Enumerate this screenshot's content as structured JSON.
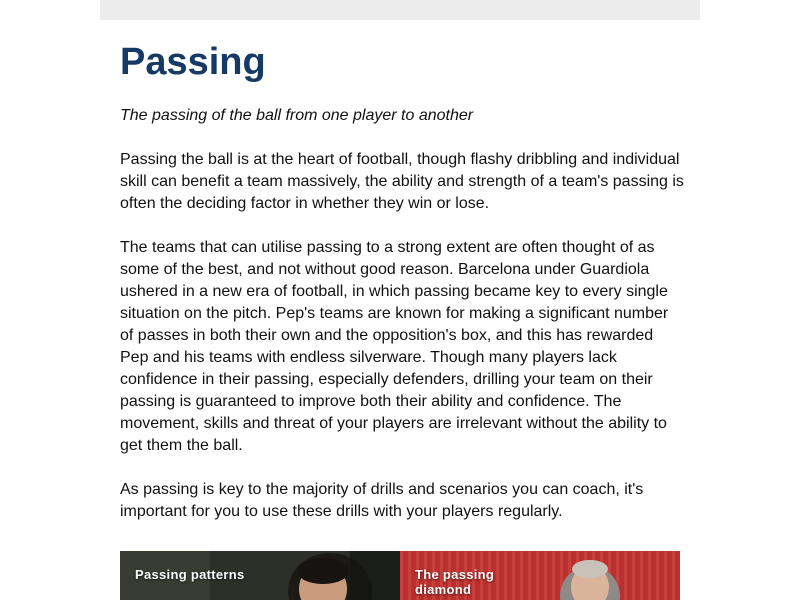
{
  "article": {
    "title": "Passing",
    "subtitle": "The passing of the ball from one player to another",
    "paragraphs": [
      "Passing the ball is at the heart of football, though flashy dribbling and individual skill can benefit a team massively, the ability and strength of a team's passing is often the deciding factor in whether they win or lose.",
      "The teams that can utilise passing to a strong extent are often thought of as some of the best, and not without good reason. Barcelona under Guardiola ushered in a new era of football, in which passing became key to every single situation on the pitch. Pep's teams are known for making a significant number of passes in both their own and the opposition's box, and this has rewarded Pep and his teams with endless silverware. Though many players lack confidence in their passing, especially defenders, drilling your team on their passing is guaranteed to improve both their ability and confidence. The movement, skills and threat of your players are irrelevant without the ability to get them the ball.",
      "As passing is key to the majority of drills and scenarios you can coach, it's important for you to use these drills with your players regularly."
    ]
  },
  "cards": [
    {
      "label": "Passing patterns",
      "image": "player-photo"
    },
    {
      "label": "The passing diamond",
      "image": "coach-photo"
    }
  ],
  "colors": {
    "title": "#163a63",
    "top_bar": "#ececec",
    "card_dark": "#2a2f26",
    "card_red": "#b72c2c"
  }
}
